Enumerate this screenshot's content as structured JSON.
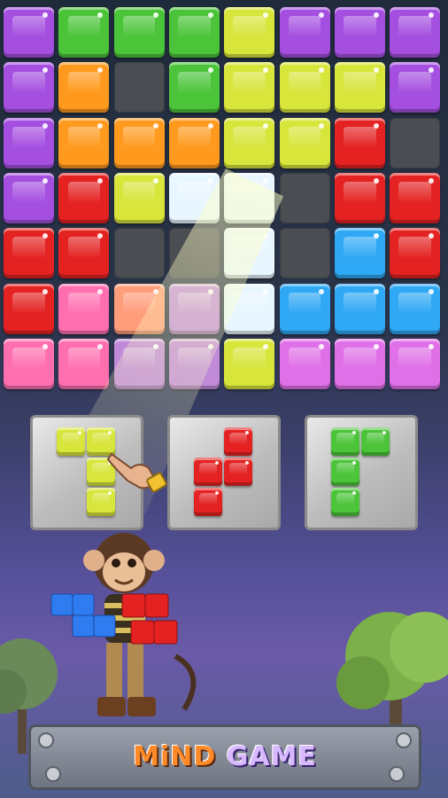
{
  "game": {
    "title_word1": "MiND",
    "title_word2": "GAME"
  },
  "colors": {
    "purple": "#a54fe0",
    "green": "#4cc43a",
    "yellow": "#d8e53a",
    "orange": "#ff9a1e",
    "red": "#e42222",
    "blue": "#2fa8f5",
    "pink": "#ff6fb0",
    "magenta": "#e070e8",
    "white": "#e8f6ff",
    "salmon": "#ff9c7a",
    "mauve": "#c08ad8",
    "empty": "#4a4d52"
  },
  "board": {
    "rows": [
      [
        "purple",
        "green",
        "green",
        "green",
        "yellow",
        "purple",
        "purple",
        "purple"
      ],
      [
        "purple",
        "orange",
        "empty",
        "green",
        "yellow",
        "yellow",
        "yellow",
        "purple"
      ],
      [
        "purple",
        "orange",
        "orange",
        "orange",
        "yellow",
        "yellow",
        "red",
        "empty"
      ],
      [
        "purple",
        "red",
        "yellow",
        "white",
        "white",
        "empty",
        "red",
        "red"
      ],
      [
        "red",
        "red",
        "empty",
        "empty",
        "white",
        "empty",
        "blue",
        "red"
      ],
      [
        "red",
        "pink",
        "salmon",
        "mauve",
        "white",
        "blue",
        "blue",
        "blue"
      ],
      [
        "pink",
        "pink",
        "mauve",
        "mauve",
        "yellow",
        "magenta",
        "magenta",
        "magenta"
      ]
    ]
  },
  "pieces": [
    {
      "name": "yellow-piece",
      "color": "yellow",
      "cells": [
        [
          0,
          0
        ],
        [
          0,
          1
        ],
        [
          1,
          1
        ],
        [
          2,
          1
        ]
      ]
    },
    {
      "name": "red-piece",
      "color": "red",
      "cells": [
        [
          0,
          1
        ],
        [
          1,
          0
        ],
        [
          1,
          1
        ],
        [
          2,
          0
        ]
      ]
    },
    {
      "name": "green-piece",
      "color": "green",
      "cells": [
        [
          0,
          0
        ],
        [
          0,
          1
        ],
        [
          1,
          0
        ],
        [
          2,
          0
        ]
      ]
    }
  ]
}
